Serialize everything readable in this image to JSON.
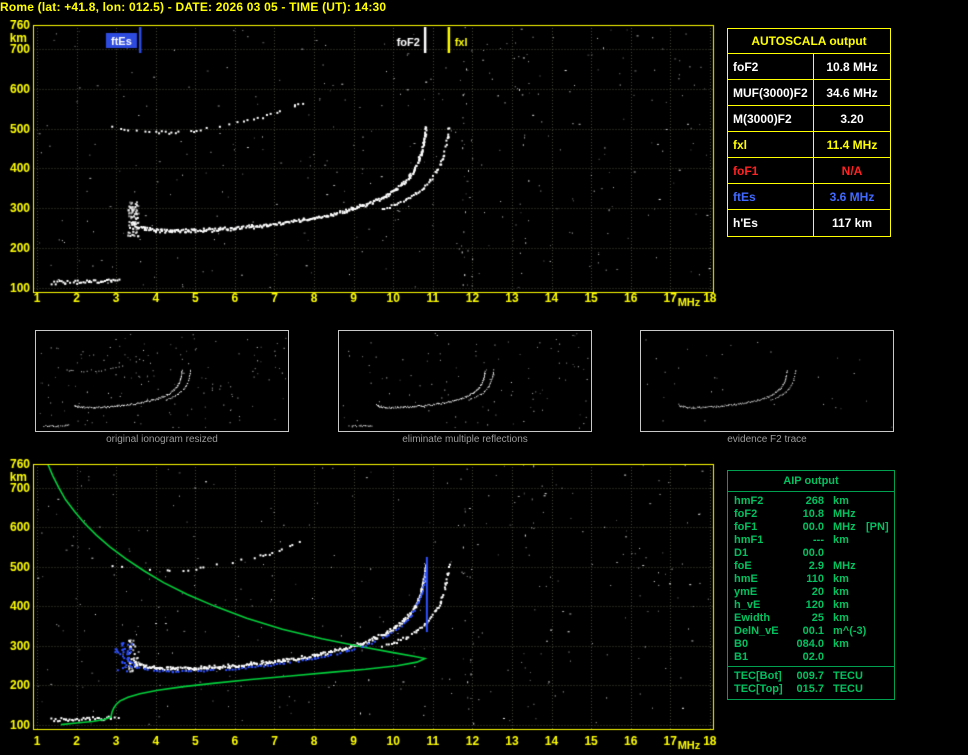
{
  "header": {
    "title": "Rome (lat: +41.8, lon: 012.5) - DATE: 2026 03 05 - TIME (UT): 14:30"
  },
  "autoscala": {
    "title": "AUTOSCALA output",
    "rows": [
      {
        "label": "foF2",
        "value": "10.8 MHz",
        "color": "#ffffff"
      },
      {
        "label": "MUF(3000)F2",
        "value": "34.6 MHz",
        "color": "#ffffff"
      },
      {
        "label": "M(3000)F2",
        "value": "3.20",
        "color": "#ffffff"
      },
      {
        "label": "fxl",
        "value": "11.4 MHz",
        "color": "#ffff00"
      },
      {
        "label": "foF1",
        "value": "N/A",
        "color": "#ff2222"
      },
      {
        "label": "ftEs",
        "value": "3.6 MHz",
        "color": "#4169ff"
      },
      {
        "label": "h'Es",
        "value": "117 km",
        "color": "#ffffff"
      }
    ]
  },
  "aip": {
    "title": "AIP output",
    "rows": [
      {
        "label": "hmF2",
        "value": "268",
        "unit": "km",
        "note": ""
      },
      {
        "label": "foF2",
        "value": "10.8",
        "unit": "MHz",
        "note": ""
      },
      {
        "label": "foF1",
        "value": "00.0",
        "unit": "MHz",
        "note": "[PN]"
      },
      {
        "label": "hmF1",
        "value": "---",
        "unit": "km",
        "note": ""
      },
      {
        "label": "D1",
        "value": "00.0",
        "unit": "",
        "note": ""
      },
      {
        "label": "foE",
        "value": "2.9",
        "unit": "MHz",
        "note": ""
      },
      {
        "label": "hmE",
        "value": "110",
        "unit": "km",
        "note": ""
      },
      {
        "label": "ymE",
        "value": "20",
        "unit": "km",
        "note": ""
      },
      {
        "label": "h_vE",
        "value": "120",
        "unit": "km",
        "note": ""
      },
      {
        "label": "Ewidth",
        "value": "25",
        "unit": "km",
        "note": ""
      },
      {
        "label": "DelN_vE",
        "value": "00.1",
        "unit": "m^(-3)",
        "note": ""
      },
      {
        "label": "B0",
        "value": "084.0",
        "unit": "km",
        "note": ""
      },
      {
        "label": "B1",
        "value": "02.0",
        "unit": "",
        "note": ""
      }
    ],
    "tec_rows": [
      {
        "label": "TEC[Bot]",
        "value": "009.7",
        "unit": "TECU",
        "note": ""
      },
      {
        "label": "TEC[Top]",
        "value": "015.7",
        "unit": "TECU",
        "note": ""
      }
    ]
  },
  "thumbnails": [
    {
      "caption": "original ionogram resized"
    },
    {
      "caption": "eliminate multiple reflections"
    },
    {
      "caption": "evidence F2 trace"
    }
  ],
  "chart_data": [
    {
      "type": "scatter",
      "name": "recorded ionogram",
      "xlabel": "MHz",
      "ylabel": "km",
      "xlim": [
        1,
        18
      ],
      "ylim": [
        100,
        760
      ],
      "grid": true,
      "x_ticks": [
        1,
        2,
        3,
        4,
        5,
        6,
        7,
        8,
        9,
        10,
        11,
        12,
        13,
        14,
        15,
        16,
        17,
        18
      ],
      "y_ticks": [
        100,
        200,
        300,
        400,
        500,
        600,
        700,
        760
      ],
      "markers": [
        {
          "label": "ftEs",
          "freq_mhz": 3.6,
          "color": "#2e4bdf",
          "text_color": "#ffffff",
          "align": "boxed"
        },
        {
          "label": "foF2",
          "freq_mhz": 10.8,
          "color": "#ffffff",
          "text_color": "#ffffff",
          "align": "right"
        },
        {
          "label": "fxl",
          "freq_mhz": 11.4,
          "color": "#ffff00",
          "text_color": "#ffff00",
          "align": "left"
        }
      ],
      "series": [
        {
          "name": "Es-trace",
          "color": "#ffffff",
          "points": [
            [
              1.35,
              116
            ],
            [
              1.7,
              116
            ],
            [
              2.0,
              117
            ],
            [
              2.3,
              118
            ],
            [
              2.6,
              119
            ],
            [
              2.85,
              120
            ],
            [
              3.05,
              121
            ]
          ]
        },
        {
          "name": "F2-ordinary-trace",
          "color": "#ffffff",
          "points": [
            [
              3.38,
              268
            ],
            [
              3.5,
              256
            ],
            [
              3.7,
              251
            ],
            [
              4.0,
              247
            ],
            [
              4.4,
              245
            ],
            [
              4.8,
              245
            ],
            [
              5.2,
              247
            ],
            [
              5.6,
              249
            ],
            [
              6.0,
              252
            ],
            [
              6.4,
              256
            ],
            [
              6.8,
              260
            ],
            [
              7.2,
              265
            ],
            [
              7.6,
              271
            ],
            [
              8.0,
              278
            ],
            [
              8.4,
              286
            ],
            [
              8.8,
              296
            ],
            [
              9.2,
              308
            ],
            [
              9.5,
              320
            ],
            [
              9.8,
              334
            ],
            [
              10.05,
              350
            ],
            [
              10.25,
              366
            ],
            [
              10.4,
              382
            ],
            [
              10.52,
              400
            ],
            [
              10.62,
              420
            ],
            [
              10.7,
              442
            ],
            [
              10.75,
              464
            ],
            [
              10.79,
              488
            ],
            [
              10.81,
              505
            ]
          ]
        },
        {
          "name": "F2-extraordinary-trace",
          "color": "#ffffff",
          "points": [
            [
              9.7,
              300
            ],
            [
              10.0,
              310
            ],
            [
              10.3,
              323
            ],
            [
              10.55,
              338
            ],
            [
              10.75,
              354
            ],
            [
              10.92,
              372
            ],
            [
              11.06,
              392
            ],
            [
              11.17,
              412
            ],
            [
              11.25,
              434
            ],
            [
              11.31,
              458
            ],
            [
              11.36,
              482
            ],
            [
              11.39,
              505
            ]
          ]
        },
        {
          "name": "multiple-reflection-trace",
          "color": "#ffffff",
          "points": [
            [
              2.9,
              507
            ],
            [
              3.2,
              501
            ],
            [
              3.5,
              497
            ],
            [
              3.9,
              494
            ],
            [
              4.3,
              493
            ],
            [
              4.7,
              495
            ],
            [
              5.1,
              499
            ],
            [
              5.5,
              505
            ],
            [
              5.9,
              512
            ],
            [
              6.3,
              521
            ],
            [
              6.7,
              532
            ],
            [
              7.1,
              545
            ],
            [
              7.5,
              560
            ],
            [
              7.9,
              576
            ]
          ]
        }
      ],
      "spread_cluster": {
        "freq_range": [
          3.28,
          3.55
        ],
        "height_range": [
          232,
          318
        ]
      }
    },
    {
      "type": "scatter",
      "name": "autoscaled ionogram with restored electron density profile",
      "xlabel": "MHz",
      "ylabel": "km",
      "xlim": [
        1,
        18
      ],
      "ylim": [
        100,
        760
      ],
      "grid": true,
      "x_ticks": [
        1,
        2,
        3,
        4,
        5,
        6,
        7,
        8,
        9,
        10,
        11,
        12,
        13,
        14,
        15,
        16,
        17,
        18
      ],
      "y_ticks": [
        100,
        200,
        300,
        400,
        500,
        600,
        700,
        760
      ],
      "series_note": "same echo traces as chart 0",
      "profile": {
        "name": "electron-density-profile",
        "color": "#00d23c",
        "points": [
          [
            1.28,
            758
          ],
          [
            1.4,
            730
          ],
          [
            1.55,
            700
          ],
          [
            1.72,
            670
          ],
          [
            1.95,
            640
          ],
          [
            2.2,
            610
          ],
          [
            2.5,
            580
          ],
          [
            2.85,
            550
          ],
          [
            3.25,
            520
          ],
          [
            3.7,
            490
          ],
          [
            4.2,
            460
          ],
          [
            4.8,
            430
          ],
          [
            5.5,
            400
          ],
          [
            6.3,
            370
          ],
          [
            7.2,
            342
          ],
          [
            8.2,
            318
          ],
          [
            9.2,
            298
          ],
          [
            10.0,
            283
          ],
          [
            10.55,
            273
          ],
          [
            10.8,
            268
          ],
          [
            10.6,
            259
          ],
          [
            10.1,
            250
          ],
          [
            9.3,
            241
          ],
          [
            8.4,
            233
          ],
          [
            7.4,
            224
          ],
          [
            6.4,
            215
          ],
          [
            5.5,
            206
          ],
          [
            4.7,
            197
          ],
          [
            4.05,
            188
          ],
          [
            3.6,
            179
          ],
          [
            3.3,
            170
          ],
          [
            3.1,
            161
          ],
          [
            3.0,
            152
          ],
          [
            2.94,
            143
          ],
          [
            2.9,
            134
          ],
          [
            2.88,
            126
          ],
          [
            2.87,
            120
          ],
          [
            2.7,
            114
          ],
          [
            2.4,
            109
          ],
          [
            2.0,
            105
          ],
          [
            1.6,
            101
          ]
        ]
      },
      "fitted_trace": {
        "name": "autoscala-fitted-F2-trace",
        "color": "#2e50ff",
        "asymptote_mhz": 10.85
      }
    }
  ]
}
